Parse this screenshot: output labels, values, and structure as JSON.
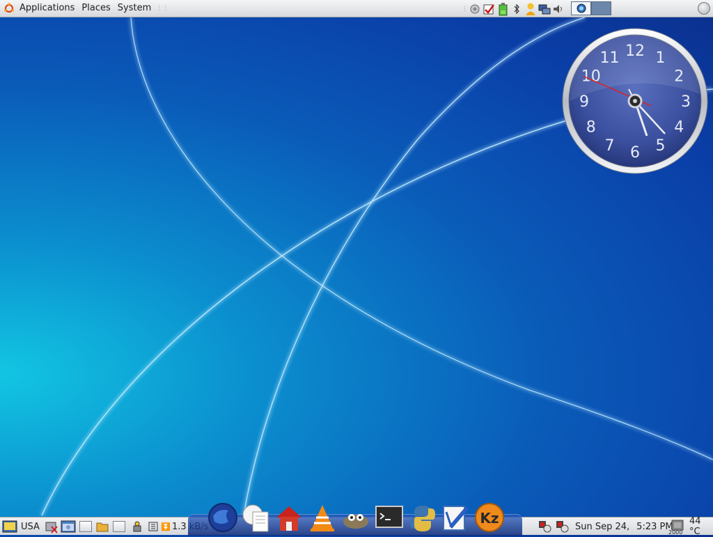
{
  "top_panel": {
    "menu": {
      "applications": "Applications",
      "places": "Places",
      "system": "System"
    },
    "tray_icons": [
      "network-icon",
      "tasks-check-icon",
      "battery-icon",
      "bluetooth-icon",
      "messenger-icon",
      "network-monitor-icon",
      "volume-icon"
    ],
    "workspaces": 2
  },
  "clock_widget": {
    "numerals": [
      "12",
      "1",
      "2",
      "3",
      "4",
      "5",
      "6",
      "7",
      "8",
      "9",
      "10",
      "11"
    ],
    "time": "5:23"
  },
  "bottom_panel": {
    "keyboard_layout": "USA",
    "net_speed": "1.3 kB/s",
    "date": "Sun Sep 24,",
    "time": "5:23 PM",
    "temperature": "44 °C",
    "cpu_freq": "2000"
  },
  "dock": {
    "items": [
      "firefox-icon",
      "documents-icon",
      "home-icon",
      "vlc-icon",
      "gimp-icon",
      "terminal-icon",
      "python-icon",
      "text-editor-icon",
      "kz-icon"
    ]
  },
  "colors": {
    "panel_bg": "#dcdfe3",
    "clock_face": "#3a4fa0",
    "accent": "#0a5ab8"
  }
}
